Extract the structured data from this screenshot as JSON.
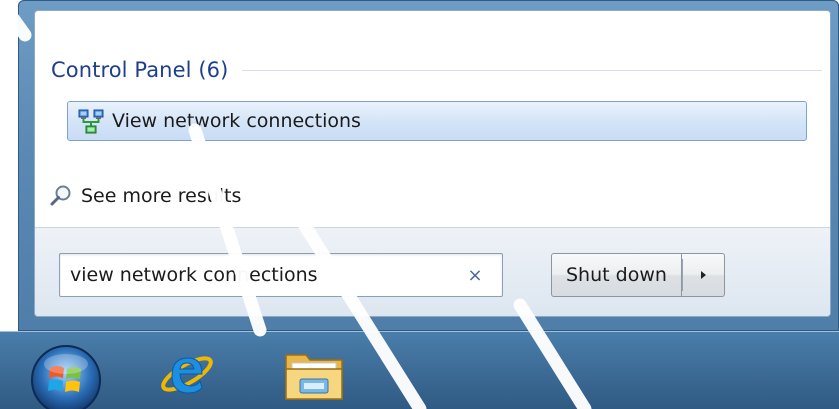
{
  "results": {
    "section_title": "Control Panel (6)",
    "items": [
      {
        "label": "View network connections",
        "icon": "network-connections-icon"
      }
    ],
    "see_more_label": "See more results"
  },
  "search": {
    "value": "view network connections",
    "clear_glyph": "×"
  },
  "power": {
    "shutdown_label": "Shut down",
    "arrow_glyph": "▸"
  },
  "taskbar": {
    "items": [
      {
        "icon": "start-orb-icon"
      },
      {
        "icon": "internet-explorer-icon"
      },
      {
        "icon": "windows-explorer-icon"
      }
    ]
  },
  "colors": {
    "section_title": "#1e3f8e",
    "highlight_border": "#7da2ce",
    "highlight_fill": "#d5e5f8",
    "taskbar": "#3f6f9a",
    "frame": "#5b89b4"
  }
}
